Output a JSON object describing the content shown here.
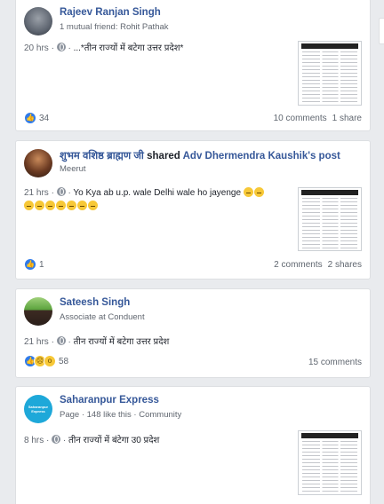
{
  "posts": [
    {
      "author": "Rajeev Ranjan Singh",
      "subtitle": "1 mutual friend: Rohit Pathak",
      "time": "20 hrs",
      "text": "...*तीन राज्यों में बटेगा उत्तर प्रदेश*",
      "reactions": "34",
      "comments": "10 comments",
      "shares": "1 share",
      "reaction_icons": [
        "like-icon"
      ]
    },
    {
      "author": "शुभम वशिष्ठ ब्राह्मण जी",
      "shared_word": "shared",
      "shared_target": "Adv Dhermendra Kaushik's post",
      "subtitle": "Meerut",
      "time": "21 hrs",
      "text": "Yo Kya ab u.p. wale Delhi wale ho jayenge",
      "reactions": "1",
      "comments": "2 comments",
      "shares": "2 shares",
      "reaction_icons": [
        "like-icon"
      ]
    },
    {
      "author": "Sateesh Singh",
      "subtitle": "Associate at Conduent",
      "time": "21 hrs",
      "text": "तीन राज्यों में बटेगा उत्तर प्रदेश",
      "reactions": "58",
      "comments": "15 comments",
      "reaction_icons": [
        "like-icon",
        "sad-icon",
        "wow-icon"
      ]
    },
    {
      "author": "Saharanpur Express",
      "subtitle": "Page · 148 like this · Community",
      "time": "8 hrs",
      "text": "तीन राज्यों में बंटेगा उ0 प्रदेश",
      "avatar_text": "Saharanpur Express"
    }
  ],
  "colors": {
    "link": "#365899",
    "like": "#2f7bea",
    "background": "#e9ebee"
  }
}
